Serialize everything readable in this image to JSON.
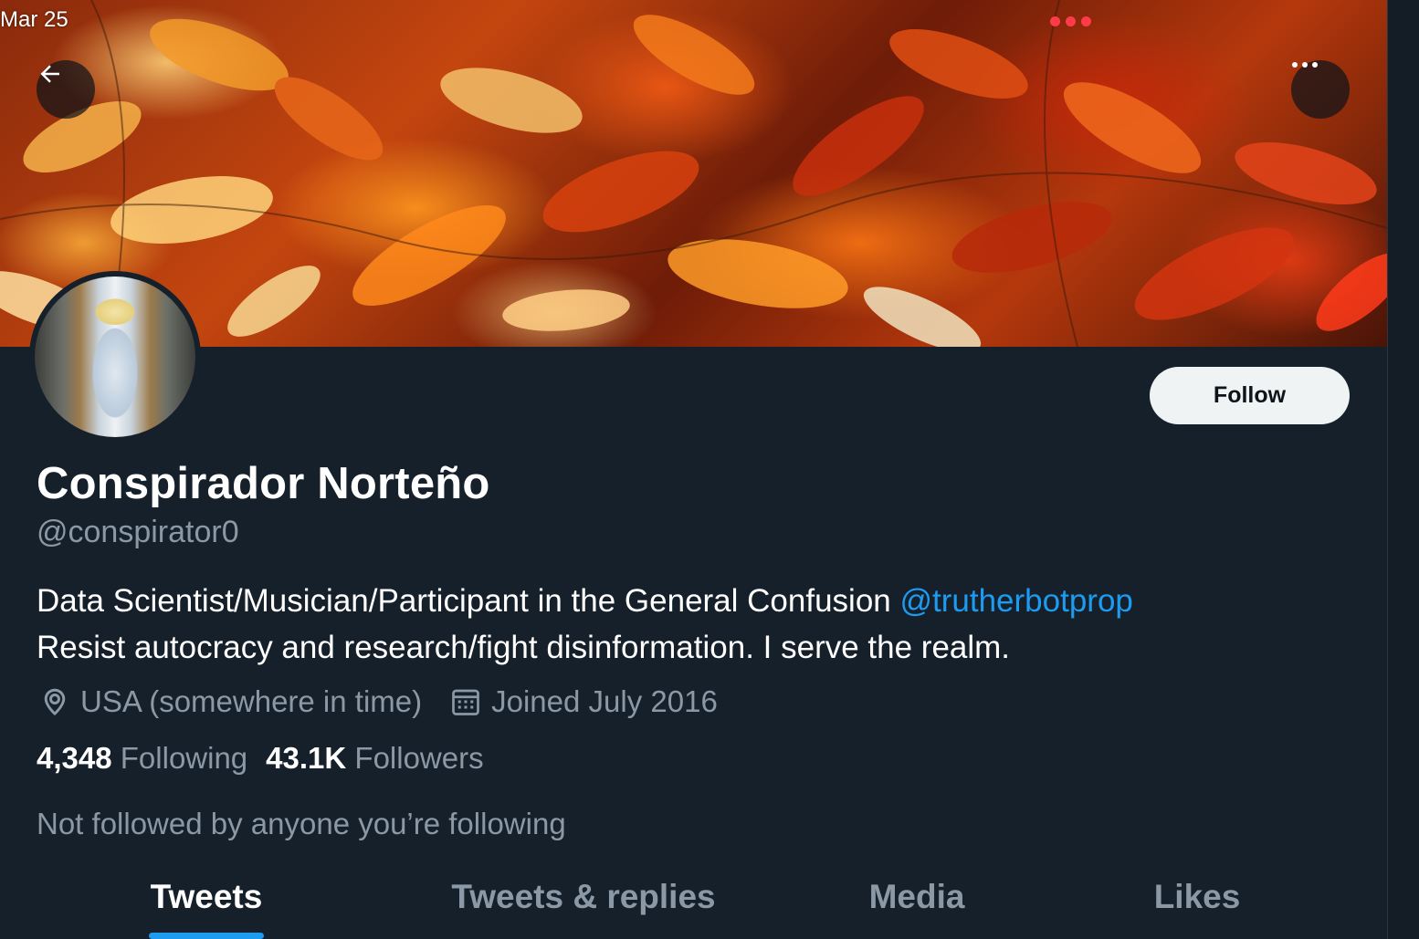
{
  "status_bar": {
    "time": "Mar 25"
  },
  "header": {
    "back_icon": "arrow-left-icon",
    "more_icon": "ellipsis-icon"
  },
  "profile": {
    "display_name": "Conspirador Norteño",
    "handle": "@conspirator0",
    "follow_label": "Follow",
    "bio_line1_text": "Data Scientist/Musician/Participant in the General Confusion ",
    "bio_line1_mention": "@trutherbotprop",
    "bio_line2": "Resist autocracy and research/fight disinformation. I serve the realm.",
    "location_icon": "location-pin-icon",
    "location": "USA (somewhere in time)",
    "joined_icon": "calendar-icon",
    "joined": "Joined July 2016",
    "following_count": "4,348",
    "following_label": "Following",
    "followers_count": "43.1K",
    "followers_label": "Followers",
    "followed_by_note": "Not followed by anyone you’re following"
  },
  "tabs": [
    {
      "label": "Tweets",
      "active": true
    },
    {
      "label": "Tweets & replies",
      "active": false
    },
    {
      "label": "Media",
      "active": false
    },
    {
      "label": "Likes",
      "active": false
    }
  ],
  "colors": {
    "background": "#15202b",
    "accent": "#1d9bf0",
    "secondary_text": "#8b98a5",
    "follow_button_bg": "#eff3f4"
  }
}
